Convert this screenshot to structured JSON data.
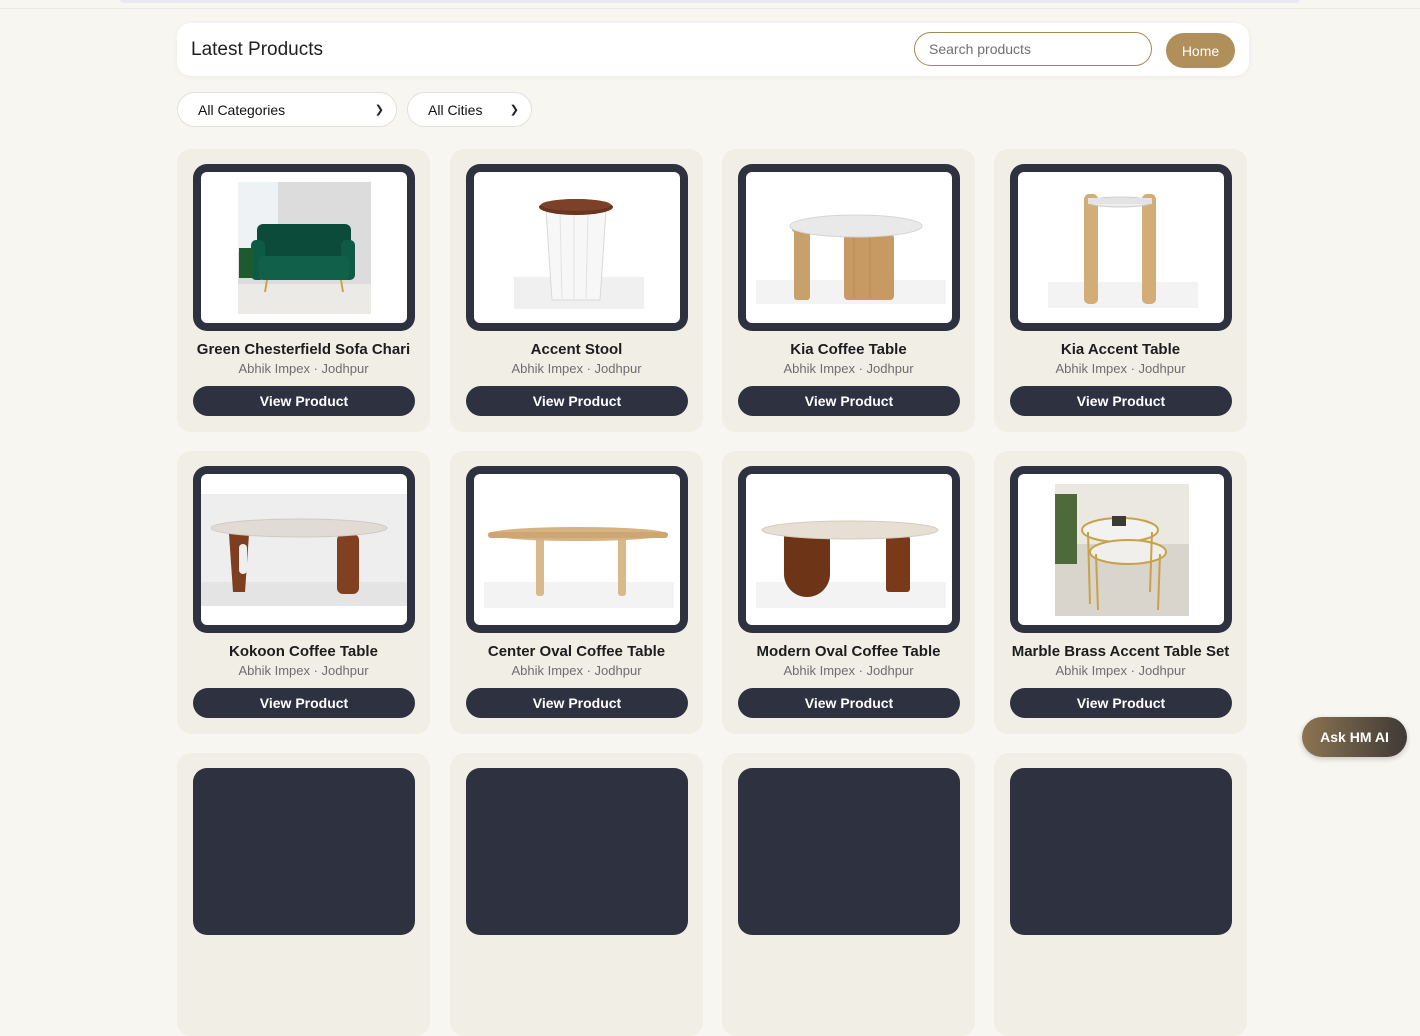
{
  "header": {
    "title": "Latest Products",
    "search_placeholder": "Search products",
    "home_label": "Home"
  },
  "filters": {
    "category": "All Categories",
    "city": "All Cities"
  },
  "view_label": "View Product",
  "products": [
    {
      "name": "Green Chesterfield Sofa Chari",
      "meta": "Abhik Impex · Jodhpur",
      "image": "green-armchair-image"
    },
    {
      "name": "Accent Stool",
      "meta": "Abhik Impex · Jodhpur",
      "image": "white-stool-image"
    },
    {
      "name": "Kia Coffee Table",
      "meta": "Abhik Impex · Jodhpur",
      "image": "marble-coffee-table-image"
    },
    {
      "name": "Kia Accent Table",
      "meta": "Abhik Impex · Jodhpur",
      "image": "tall-accent-table-image"
    },
    {
      "name": "Kokoon Coffee Table",
      "meta": "Abhik Impex · Jodhpur",
      "image": "oval-coffee-table-image"
    },
    {
      "name": "Center Oval Coffee Table",
      "meta": "Abhik Impex · Jodhpur",
      "image": "wood-oval-table-image"
    },
    {
      "name": "Modern Oval Coffee Table",
      "meta": "Abhik Impex · Jodhpur",
      "image": "modern-oval-table-image"
    },
    {
      "name": "Marble Brass Accent Table Set",
      "meta": "Abhik Impex · Jodhpur",
      "image": "brass-nesting-tables-image"
    }
  ],
  "assistant_button": "Ask HM AI",
  "colors": {
    "accent": "#b08f5a",
    "dark": "#2d3140",
    "card_bg": "#f1eee6",
    "page_bg": "#f8f6f0"
  }
}
